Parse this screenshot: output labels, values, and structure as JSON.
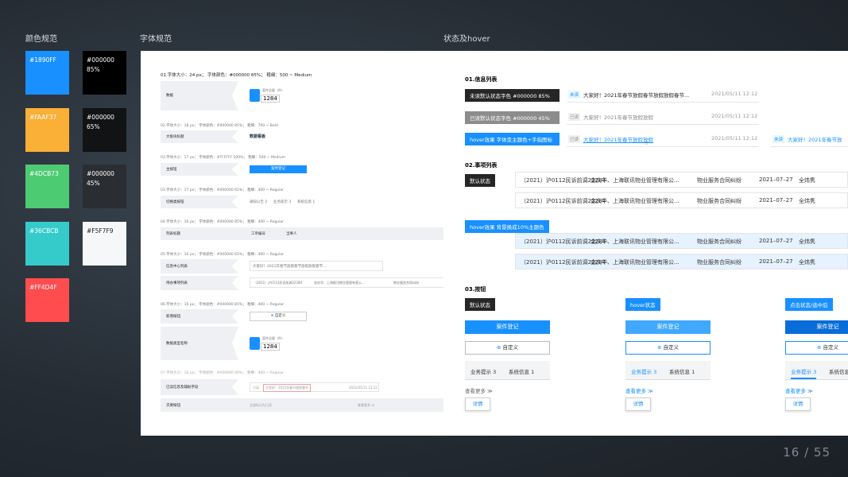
{
  "sections": {
    "color": "颜色规范",
    "font": "字体规范",
    "state": "状态及hover"
  },
  "swatches": [
    {
      "label": "#1890FF",
      "bg": "#1890FF"
    },
    {
      "label": "#000000\n85%",
      "bg": "#000000"
    },
    {
      "label": "#FAAF37",
      "bg": "#FAAF37"
    },
    {
      "label": "#000000\n65%",
      "bg": "#111315"
    },
    {
      "label": "#4DCB73",
      "bg": "#4DCB73"
    },
    {
      "label": "#000000\n45%",
      "bg": "#2a2d31"
    },
    {
      "label": "#36CBCB",
      "bg": "#36CBCB"
    },
    {
      "label": "#F5F7F9",
      "bg": "#F5F7F9"
    },
    {
      "label": "#FF4D4F",
      "bg": "#FF4D4F"
    }
  ],
  "font": {
    "spec1": "01.字体大小：24 px；  字体颜色：#000000  85%；  粗细：500 ~ Medium",
    "r1_label": "数据",
    "r1_card_title": "案件总量（件）",
    "r1_card_value": "1284",
    "spec2": "02.字体大小：18 px；  字体颜色：#000000  85%；  粗细：700 ~ Bold",
    "r2_label": "大板块标题",
    "r2_value": "数据看板",
    "spec3": "03.字体大小：17 px；  字体颜色：#FFFFFF  100%；  粗细：500 ~ Medium",
    "r3_label": "主按钮",
    "r3_btn": "案件登记",
    "spec3b": "03.字体大小：17 px；  字体颜色：#000000  65%；  粗细：400 ~ Regular",
    "r3b_label": "切换类按钮",
    "r3b_items": [
      "通知公告 2",
      "业务提示 3",
      "系统信息 1"
    ],
    "spec4": "04.字体大小：16 px；  字体颜色：#000000  85%；  粗细：400 ~ Regular",
    "r4_label": "列表标题",
    "r4_items": [
      "工单编号",
      "当事人"
    ],
    "spec5": "05.字体大小：16 px；  字体颜色：#000000  65%；  粗细：400 ~ Regular",
    "r5a_label": "信息中心列表",
    "r5a_text": "大家好！2021年春节放假春节放假放假春节...",
    "r5b_label": "待办事项列表",
    "r5b_items": [
      "（2021）沪0112民诉前调22284",
      "金庆华、上海联讯物业管理有限公...",
      "物业服务合同纠纷"
    ],
    "spec6": "06.字体大小：16 px；  字体颜色：#000000  85%；  粗细：400 ~ Regular",
    "r6_label": "新增按钮",
    "r6_btn": "自定义",
    "r6b_label": "数据类型名称",
    "r6b_card_title": "案件总量（件）",
    "r6b_card_value": "1284",
    "spec7": "07.字体大小：16 px；  字体颜色：#000000  40%；  粗细：400 ~ Regular",
    "r7a_label": "已读信息及辅助字段",
    "r7a_tag": "已读",
    "r7a_text": "大家好！2021年春节放假春节",
    "r7a_date": "2021/05/11 12:12",
    "r7b_label": "次要按钮",
    "r7b_text": "全部标记为已读",
    "r7b_more": "查看更多 ≫"
  },
  "state": {
    "s1": "01.信息列表",
    "tag_unread": "未读默认状态字色   #000000 85%",
    "tag_read": "已读默认状态字色   #000000 45%",
    "tag_hover": "hover效果  字体变主题色+手指图标",
    "msg_unread": {
      "badge": "未读",
      "text": "大家好！2021年春节放假春节放假放假春节...",
      "date": "2021/05/11 12:12"
    },
    "msg_read": {
      "badge": "已读",
      "text": "大家好！2021年春节放假放假",
      "date": "2021/05/11 12:12"
    },
    "msg_hover": {
      "badge": "已读",
      "text": "大家好！2021年春节放假放假",
      "date": "2021/05/11 12:12"
    },
    "msg_hover2": {
      "badge": "未读",
      "text": "大家好！2021年春节放"
    },
    "s2": "02.事项列表",
    "tag_default": "默认状态",
    "tag_hover2": "hover效果    背景换成10%主题色",
    "row": {
      "a": "（2021）沪0112民诉前调22284",
      "b": "金庆华、上海联讯物业管理有限公...",
      "c": "物业服务合同纠纷",
      "d": "2021–07–27",
      "e": "全炜隽"
    },
    "s3": "03.按钮",
    "col_default": "默认状态",
    "col_hover": "hover状态",
    "col_active": "点击状态/选中后",
    "btn_primary": "案件登记",
    "btn_custom": "自定义",
    "tab1": "业务提示 3",
    "tab2": "系统信息 1",
    "more": "查看更多 ≫",
    "detail": "详情"
  },
  "page": "16 / 55"
}
